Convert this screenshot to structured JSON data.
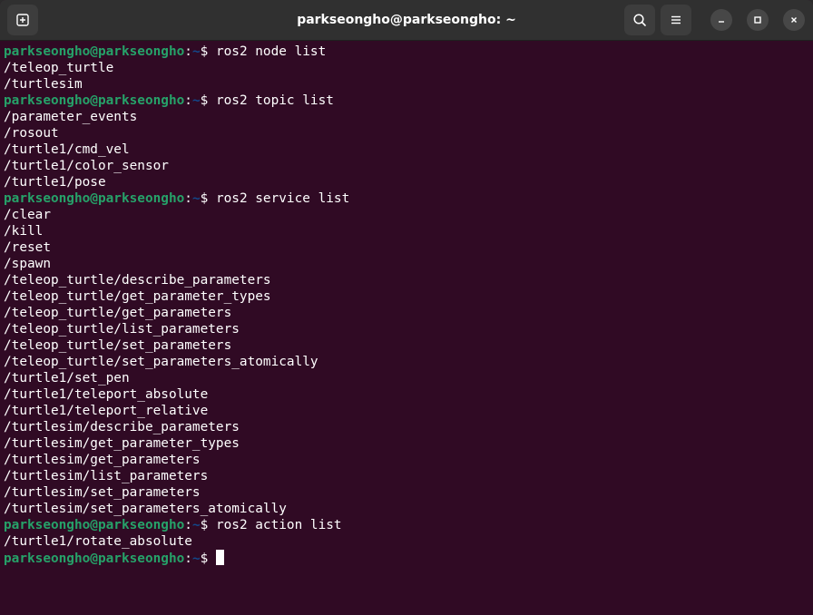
{
  "window": {
    "title": "parkseongho@parkseongho: ~"
  },
  "icons": {
    "new_tab": "new-tab-icon",
    "search": "search-icon",
    "menu": "hamburger-menu-icon",
    "minimize": "minimize-icon",
    "maximize": "maximize-icon",
    "close": "close-icon"
  },
  "colors": {
    "background": "#300a24",
    "titlebar": "#303030",
    "prompt_user": "#26a269",
    "prompt_path": "#12488b",
    "text": "#ffffff"
  },
  "prompt": {
    "user_host": "parkseongho@parkseongho",
    "colon": ":",
    "path": "~",
    "symbol": "$ "
  },
  "terminal": {
    "lines": [
      {
        "type": "cmd",
        "text": "ros2 node list"
      },
      {
        "type": "out",
        "text": "/teleop_turtle"
      },
      {
        "type": "out",
        "text": "/turtlesim"
      },
      {
        "type": "cmd",
        "text": "ros2 topic list"
      },
      {
        "type": "out",
        "text": "/parameter_events"
      },
      {
        "type": "out",
        "text": "/rosout"
      },
      {
        "type": "out",
        "text": "/turtle1/cmd_vel"
      },
      {
        "type": "out",
        "text": "/turtle1/color_sensor"
      },
      {
        "type": "out",
        "text": "/turtle1/pose"
      },
      {
        "type": "cmd",
        "text": "ros2 service list"
      },
      {
        "type": "out",
        "text": "/clear"
      },
      {
        "type": "out",
        "text": "/kill"
      },
      {
        "type": "out",
        "text": "/reset"
      },
      {
        "type": "out",
        "text": "/spawn"
      },
      {
        "type": "out",
        "text": "/teleop_turtle/describe_parameters"
      },
      {
        "type": "out",
        "text": "/teleop_turtle/get_parameter_types"
      },
      {
        "type": "out",
        "text": "/teleop_turtle/get_parameters"
      },
      {
        "type": "out",
        "text": "/teleop_turtle/list_parameters"
      },
      {
        "type": "out",
        "text": "/teleop_turtle/set_parameters"
      },
      {
        "type": "out",
        "text": "/teleop_turtle/set_parameters_atomically"
      },
      {
        "type": "out",
        "text": "/turtle1/set_pen"
      },
      {
        "type": "out",
        "text": "/turtle1/teleport_absolute"
      },
      {
        "type": "out",
        "text": "/turtle1/teleport_relative"
      },
      {
        "type": "out",
        "text": "/turtlesim/describe_parameters"
      },
      {
        "type": "out",
        "text": "/turtlesim/get_parameter_types"
      },
      {
        "type": "out",
        "text": "/turtlesim/get_parameters"
      },
      {
        "type": "out",
        "text": "/turtlesim/list_parameters"
      },
      {
        "type": "out",
        "text": "/turtlesim/set_parameters"
      },
      {
        "type": "out",
        "text": "/turtlesim/set_parameters_atomically"
      },
      {
        "type": "cmd",
        "text": "ros2 action list"
      },
      {
        "type": "out",
        "text": "/turtle1/rotate_absolute"
      },
      {
        "type": "cmd",
        "text": ""
      }
    ]
  }
}
